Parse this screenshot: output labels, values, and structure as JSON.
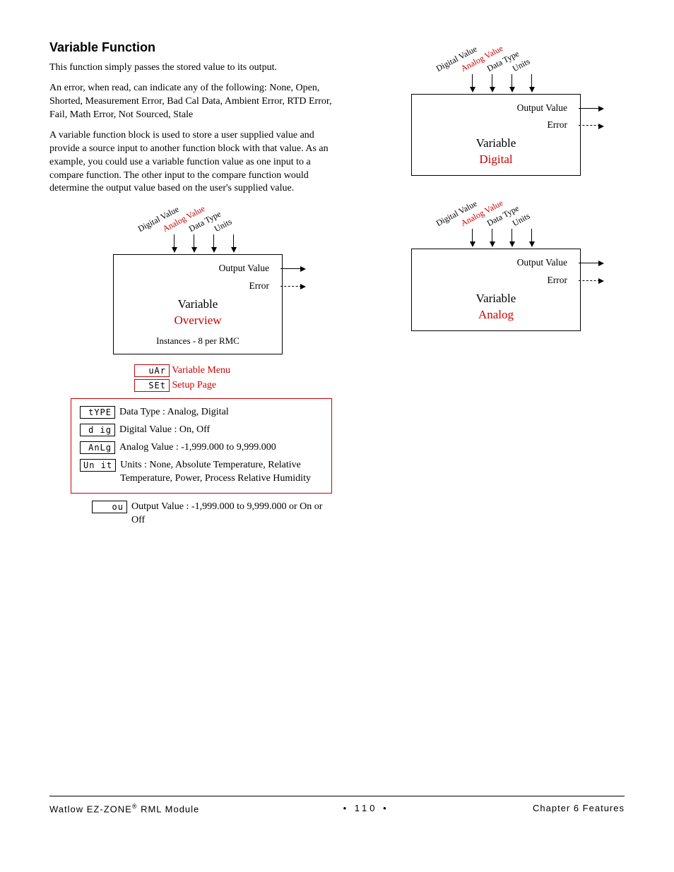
{
  "section_title": "Variable Function",
  "paragraphs": {
    "p1": "This function simply passes the stored value to its output.",
    "p2": "An error, when read, can indicate any of the following: None, Open, Shorted, Measurement Error, Bad Cal Data, Ambient Error, RTD Error, Fail, Math Error, Not Sourced, Stale",
    "p3": "A variable function block is used to store a user supplied value and provide a source input to another function block with that value. As an example, you could use a variable function value as one input to a compare function. The other input to the compare function would determine the output value based on the user's supplied value."
  },
  "diagram_inputs": {
    "digital_value": "Digital Value",
    "analog_value": "Analog Value",
    "data_type": "Data Type",
    "units": "Units"
  },
  "diagram_outputs": {
    "output_value": "Output Value",
    "error": "Error"
  },
  "block_title": "Variable",
  "block_sub_overview": "Overview",
  "block_sub_digital": "Digital",
  "block_sub_analog": "Analog",
  "instances_line": "Instances - 8 per RMC",
  "leds": {
    "var": "uAr",
    "set": "SEt",
    "type": "tYPE",
    "dig": "d ig",
    "anlg": "AnLg",
    "unit": "Un it",
    "ou": "ou"
  },
  "menu_lines": {
    "variable_menu": "Variable Menu",
    "setup_page": "Setup Page"
  },
  "params": {
    "type": "Data Type : Analog, Digital",
    "dig": "Digital Value : On, Off",
    "anlg": "Analog Value : -1,999.000 to 9,999.000",
    "unit": "Units : None, Absolute Temperature, Relative Temperature, Power, Process Relative Humidity",
    "ou": "Output Value : -1,999.000 to 9,999.000 or On or Off"
  },
  "footer": {
    "left": "Watlow EZ-ZONE",
    "left2": " RML Module",
    "page": "110",
    "right": "Chapter 6 Features"
  }
}
